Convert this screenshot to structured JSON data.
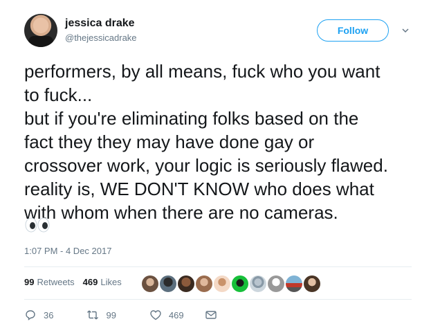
{
  "user": {
    "name": "jessica drake",
    "handle": "@thejessicadrake"
  },
  "follow_label": "Follow",
  "tweet_lines": [
    "performers, by all means, fuck who you want",
    "to fuck...",
    "but if you're eliminating folks based on the",
    "fact they they may have done gay or",
    "crossover work, your logic is seriously flawed.",
    "reality is, WE DON'T KNOW who does what",
    "with whom when there are no cameras."
  ],
  "emoji": "eyes",
  "timestamp": "1:07 PM - 4 Dec 2017",
  "stats": {
    "retweets_count": "99",
    "retweets_label": "Retweets",
    "likes_count": "469",
    "likes_label": "Likes"
  },
  "actions": {
    "replies": "36",
    "retweets": "99",
    "likes": "469"
  },
  "colors": {
    "accent": "#1da1f2",
    "muted": "#657786",
    "text": "#14171a",
    "divider": "#e6ecf0"
  }
}
